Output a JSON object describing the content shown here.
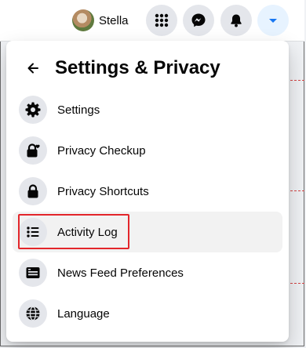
{
  "header": {
    "profile_name": "Stella",
    "icons": [
      "menu-grid-icon",
      "messenger-icon",
      "bell-icon",
      "caret-down-icon"
    ]
  },
  "panel": {
    "title": "Settings & Privacy",
    "items": [
      {
        "label": "Settings",
        "icon": "gear-icon"
      },
      {
        "label": "Privacy Checkup",
        "icon": "lock-heart-icon"
      },
      {
        "label": "Privacy Shortcuts",
        "icon": "lock-icon"
      },
      {
        "label": "Activity Log",
        "icon": "list-icon",
        "highlighted": true
      },
      {
        "label": "News Feed Preferences",
        "icon": "feed-icon"
      },
      {
        "label": "Language",
        "icon": "globe-icon"
      }
    ]
  },
  "colors": {
    "accent": "#1877f2",
    "highlight_border": "#e3262b",
    "icon_bg": "#e4e6eb"
  }
}
